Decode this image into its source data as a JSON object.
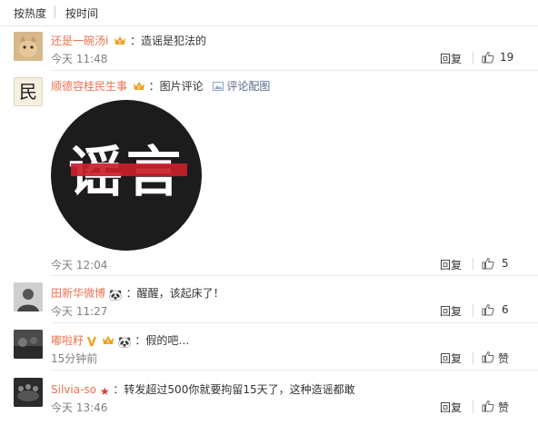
{
  "sort": {
    "hot": "按热度",
    "time": "按时间"
  },
  "comments": [
    {
      "user": "还是一碗汤i",
      "text": "：造谣是犯法的",
      "time": "今天 11:48",
      "reply": "回复",
      "likes": "19"
    },
    {
      "user": "顺德容桂民生事",
      "tag": "：图片评论",
      "view_pic": "评论配图",
      "image_text": "谣言",
      "avatar_text": "民",
      "time": "今天 12:04",
      "reply": "回复",
      "likes": "5"
    },
    {
      "user": "田新华微博",
      "text": "：醒醒，该起床了！",
      "time": "今天 11:27",
      "reply": "回复",
      "likes": "6"
    },
    {
      "user": "嘟啦籽",
      "text": "：假的吧…",
      "time": "15分钟前",
      "reply": "回复",
      "likes": "赞"
    },
    {
      "user": "Silvia-so",
      "text": "：转发超过500你就要拘留15天了，这种造谣都敢",
      "time": "今天 13:46",
      "reply": "回复",
      "likes": "赞"
    }
  ]
}
